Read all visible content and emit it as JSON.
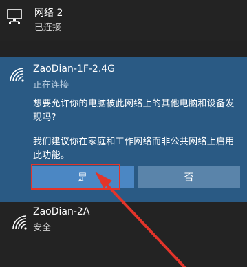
{
  "networks": {
    "wired": {
      "name": "网络 2",
      "status": "已连接",
      "icon": "ethernet-monitor-icon"
    },
    "connecting": {
      "name": "ZaoDian-1F-2.4G",
      "status": "正在连接",
      "icon": "wifi-icon",
      "prompt_question": "想要允许你的电脑被此网络上的其他电脑和设备发现吗?",
      "prompt_advice": "我们建议你在家庭和工作网络而非公共网络上启用此功能。",
      "yes_label": "是",
      "no_label": "否"
    },
    "secured": {
      "name": "ZaoDian-2A",
      "status": "安全",
      "icon": "wifi-secured-icon"
    }
  },
  "colors": {
    "background": "#222222",
    "panel_active": "#2a5a84",
    "button_yes": "#4b87c4",
    "button_no": "#5a84aa",
    "annotation_red": "#e3342a"
  }
}
